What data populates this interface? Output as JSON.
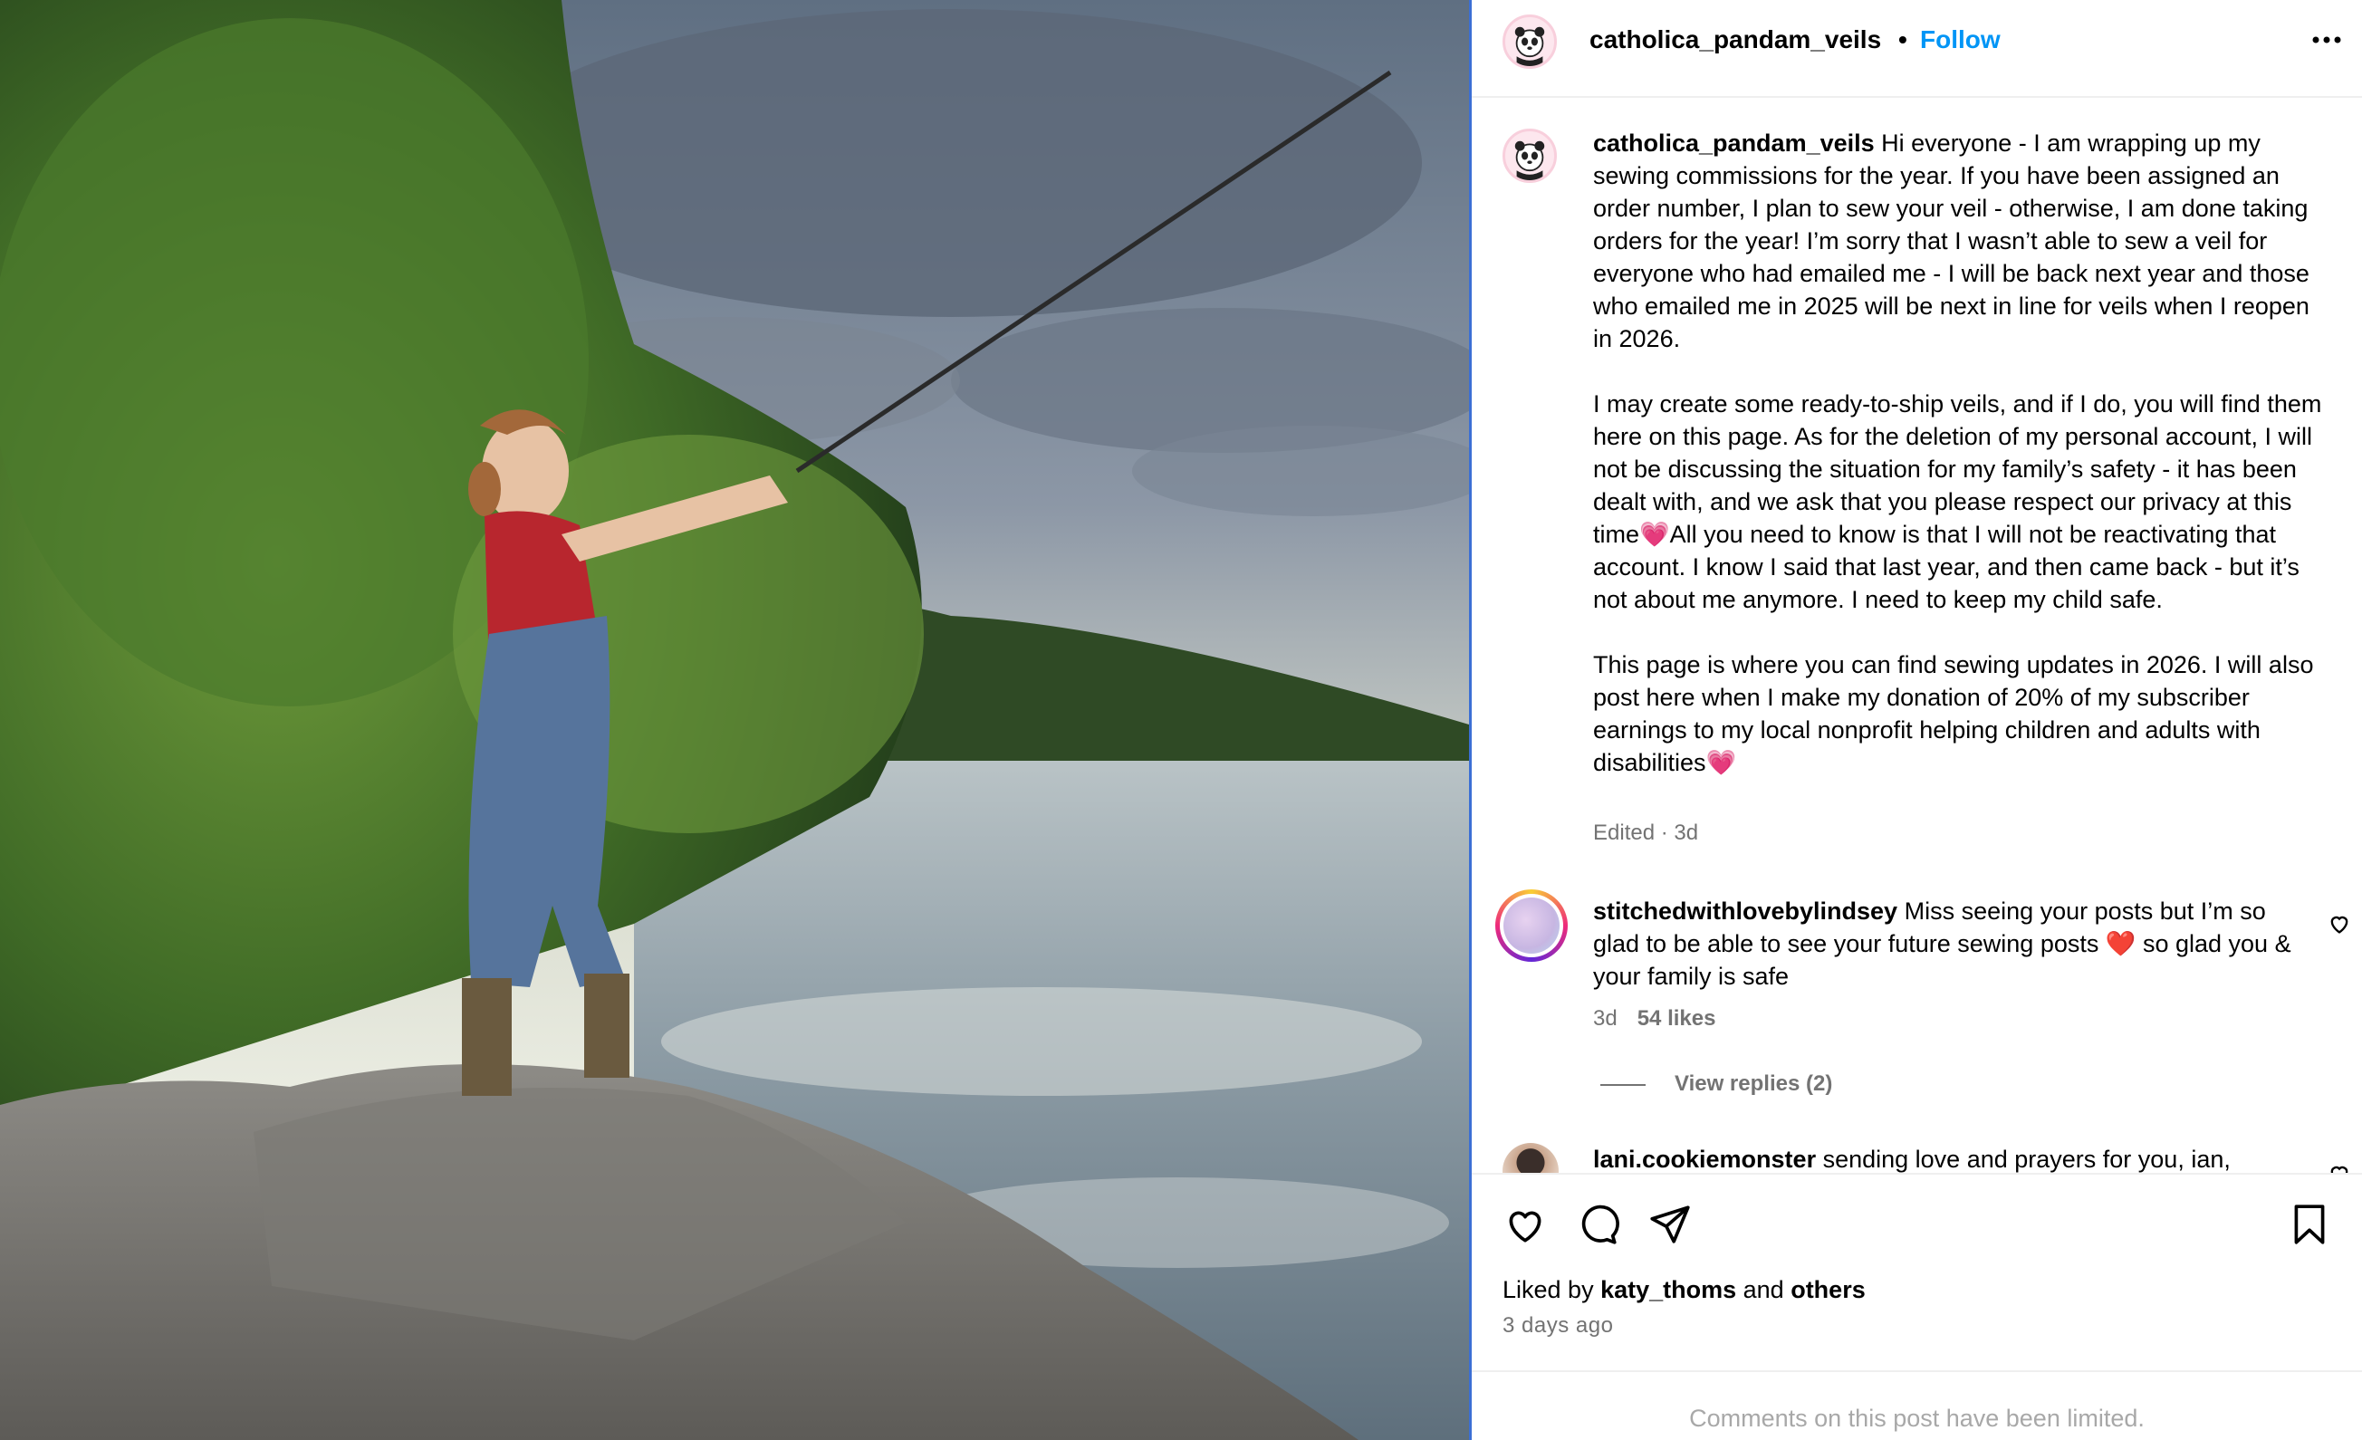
{
  "post": {
    "username": "catholica_pandam_veils",
    "separator": "•",
    "follow_label": "Follow",
    "more_icon": "more-horizontal-icon"
  },
  "caption": {
    "username": "catholica_pandam_veils",
    "text": " Hi everyone - I am wrapping up my sewing commissions for the year. If you have been assigned an order number, I plan to sew your veil - otherwise, I am done taking orders for the year! I’m sorry that I wasn’t able to sew a veil for everyone who had emailed me - I will be back next year and those who emailed me in 2025 will be next in line for veils when I reopen in 2026.\n\nI may create some ready-to-ship veils, and if I do, you will find them here on this page. As for the deletion of my personal account, I will not be discussing the situation for my family’s safety - it has been dealt with, and we ask that you please respect our privacy at this time💗All you need to know is that I will not be reactivating that account. I know I said that last year, and then came back - but it’s not about me anymore. I need to keep my child safe.\n\nThis page is where you can find sewing updates in 2026. I will also post here when I make my donation of 20% of my subscriber earnings to my local nonprofit helping children and adults with disabilities💗",
    "meta": "Edited · 3d"
  },
  "comments": [
    {
      "username": "stitchedwithlovebylindsey",
      "text": " Miss seeing your posts but I’m so glad to be able to see your future sewing posts ❤️ so glad you & your family is safe",
      "time": "3d",
      "likes": "54 likes",
      "replies": "View replies (2)"
    },
    {
      "username": "lani.cookiemonster",
      "text": " sending love and prayers for you, ian,"
    }
  ],
  "actions": {
    "icons": [
      "heart-icon",
      "comment-icon",
      "share-icon",
      "bookmark-icon"
    ]
  },
  "likes": {
    "prefix": "Liked by ",
    "user": "katy_thoms",
    "mid": " and ",
    "others": "others"
  },
  "date": "3 days ago",
  "comments_limited": "Comments on this post have been limited.",
  "colors": {
    "follow": "#0095f6",
    "muted": "#737373",
    "divider": "#3b6fd4"
  }
}
